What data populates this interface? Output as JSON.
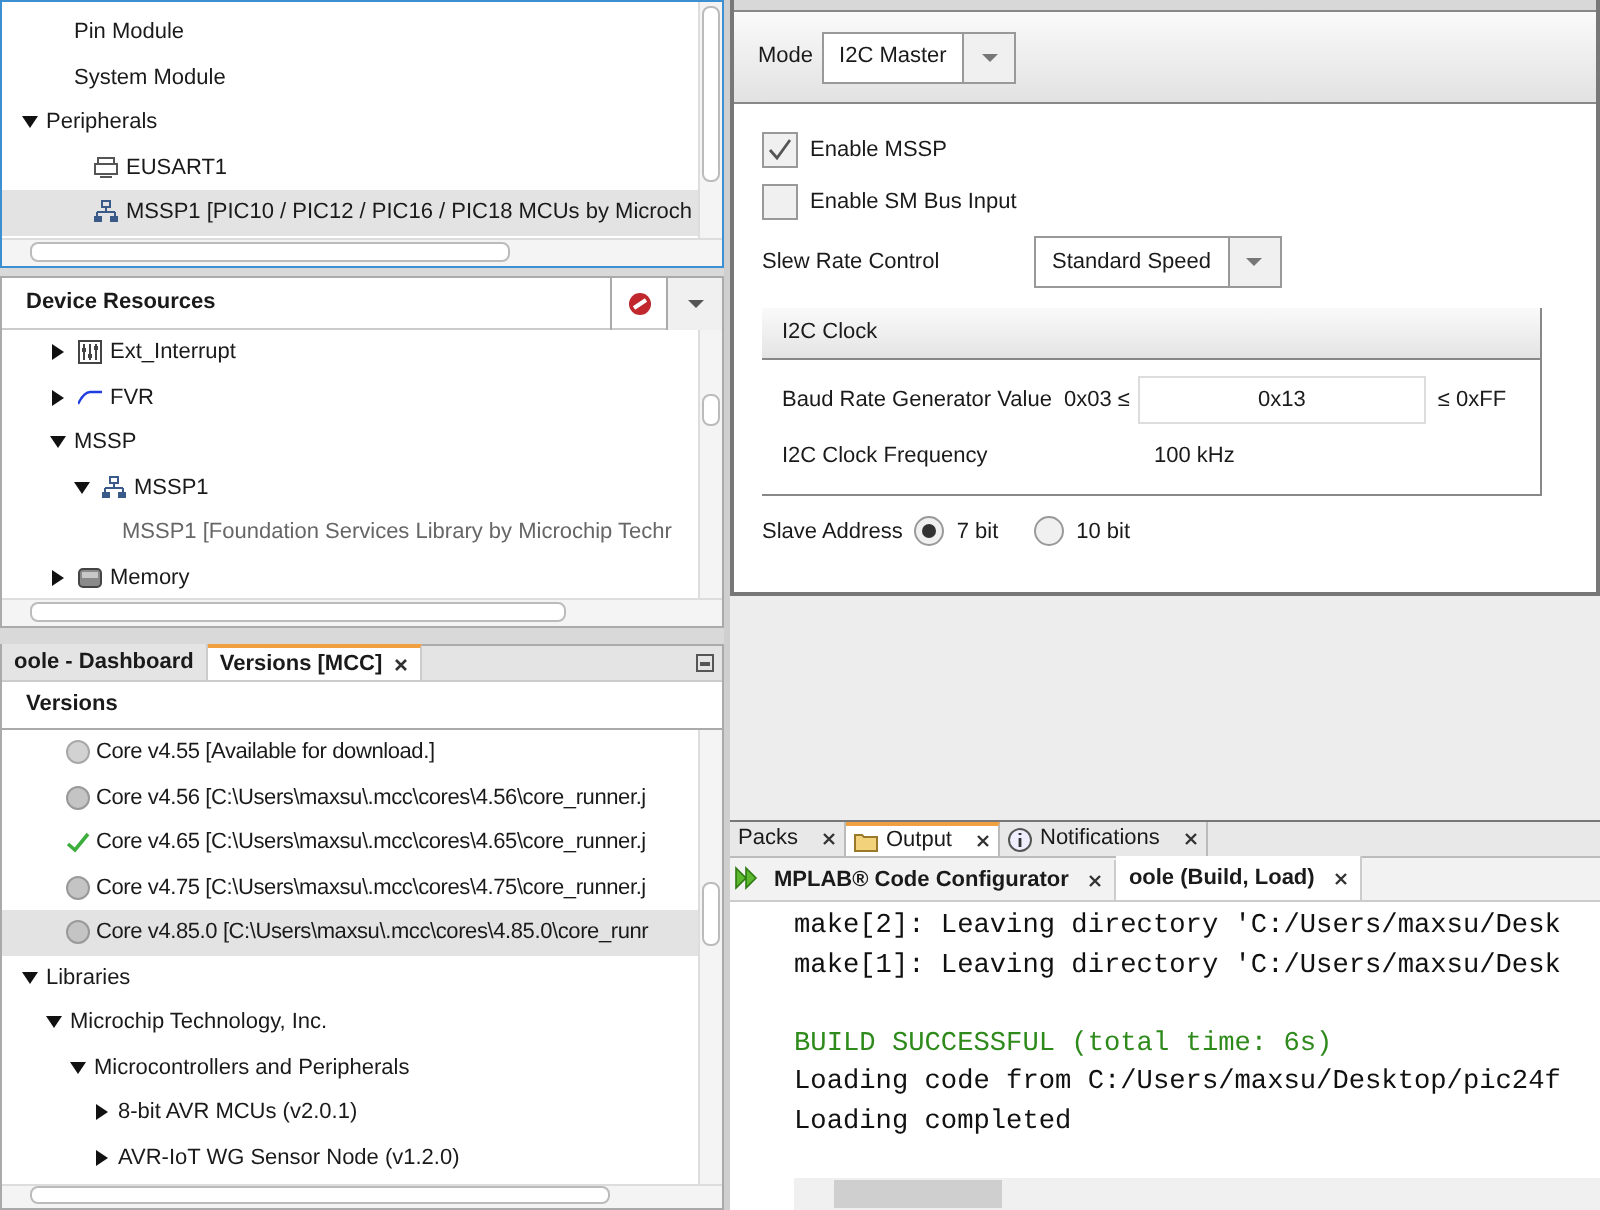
{
  "project_tree": {
    "items": [
      {
        "label": "Pin Module",
        "kind": "module"
      },
      {
        "label": "System Module",
        "kind": "module"
      },
      {
        "label": "Peripherals",
        "kind": "folder",
        "expanded": true,
        "selected": false,
        "children": [
          {
            "label": "EUSART1",
            "kind": "serial",
            "selected": false
          },
          {
            "label": "MSSP1 [PIC10 / PIC12 / PIC16 / PIC18 MCUs  by Microch",
            "kind": "peripheral",
            "selected": true
          }
        ]
      }
    ]
  },
  "device_resources": {
    "title": "Device Resources",
    "items": [
      {
        "label": "Ext_Interrupt",
        "kind": "interrupt",
        "expanded": false
      },
      {
        "label": "FVR",
        "kind": "fvr",
        "expanded": false
      },
      {
        "label": "MSSP",
        "kind": "folder",
        "expanded": true,
        "children": [
          {
            "label": "MSSP1",
            "kind": "peripheral",
            "expanded": true,
            "children": [
              {
                "label": "MSSP1 [Foundation Services Library by Microchip Techr",
                "kind": "library"
              }
            ]
          }
        ]
      },
      {
        "label": "Memory",
        "kind": "memory",
        "expanded": false
      }
    ]
  },
  "bottom_tabs": [
    {
      "label": "oole - Dashboard",
      "selected": false
    },
    {
      "label": "Versions [MCC]",
      "selected": true
    }
  ],
  "versions": {
    "title": "Versions",
    "cores": [
      {
        "label": "Core v4.55 [Available for download.]",
        "kind": "available",
        "selected": false
      },
      {
        "label": "Core v4.56 [C:\\Users\\maxsu\\.mcc\\cores\\4.56\\core_runner.j",
        "kind": "installed",
        "selected": false
      },
      {
        "label": "Core v4.65 [C:\\Users\\maxsu\\.mcc\\cores\\4.65\\core_runner.j",
        "kind": "active",
        "selected": false
      },
      {
        "label": "Core v4.75 [C:\\Users\\maxsu\\.mcc\\cores\\4.75\\core_runner.j",
        "kind": "installed",
        "selected": false
      },
      {
        "label": "Core v4.85.0 [C:\\Users\\maxsu\\.mcc\\cores\\4.85.0\\core_runr",
        "kind": "installed",
        "selected": true
      }
    ],
    "libraries": [
      {
        "label": "Libraries",
        "expanded": true,
        "children": [
          {
            "label": "Microchip Technology, Inc.",
            "expanded": true,
            "children": [
              {
                "label": "Microcontrollers and Peripherals",
                "expanded": true,
                "children": [
                  {
                    "label": "8-bit AVR MCUs (v2.0.1)",
                    "expanded": false
                  },
                  {
                    "label": "AVR-IoT WG Sensor Node (v1.2.0)",
                    "expanded": false
                  }
                ]
              }
            ]
          }
        ]
      }
    ]
  },
  "hardware_settings": {
    "mode_label": "Mode",
    "mode": "I2C Master",
    "checkboxes": [
      {
        "label": "Enable MSSP",
        "checked": true
      },
      {
        "label": "Enable SM Bus Input",
        "checked": false
      }
    ],
    "slew_label": "Slew Rate Control",
    "slew": "Standard Speed",
    "clock": {
      "title": "I2C Clock",
      "baud_label": "Baud Rate Generator Value",
      "baud_min": "0x03 ≤",
      "baud_value": "0x13",
      "baud_max": "≤ 0xFF",
      "freq_label": "I2C Clock Frequency",
      "freq": "100 kHz"
    },
    "slave_label": "Slave Address",
    "slave_options": [
      {
        "label": "7 bit",
        "selected": true
      },
      {
        "label": "10 bit",
        "selected": false
      }
    ]
  },
  "output": {
    "tabs": [
      {
        "label": "Packs",
        "kind": "plain",
        "selected": false
      },
      {
        "label": "Output",
        "kind": "output",
        "selected": true
      },
      {
        "label": "Notifications",
        "kind": "info",
        "selected": false
      }
    ],
    "subtabs": [
      {
        "label": "MPLAB® Code Configurator",
        "selected": false
      },
      {
        "label": "oole (Build, Load)",
        "selected": true
      }
    ],
    "lines": [
      {
        "text": "make[2]: Leaving directory 'C:/Users/maxsu/Desk",
        "kind": "normal"
      },
      {
        "text": "make[1]: Leaving directory 'C:/Users/maxsu/Desk",
        "kind": "normal"
      },
      {
        "kind": "blank"
      },
      {
        "text": "BUILD SUCCESSFUL (total time: 6s)",
        "kind": "success"
      },
      {
        "text": "Loading code from C:/Users/maxsu/Desktop/pic24f",
        "kind": "normal"
      },
      {
        "text": "Loading completed",
        "kind": "normal"
      }
    ]
  }
}
